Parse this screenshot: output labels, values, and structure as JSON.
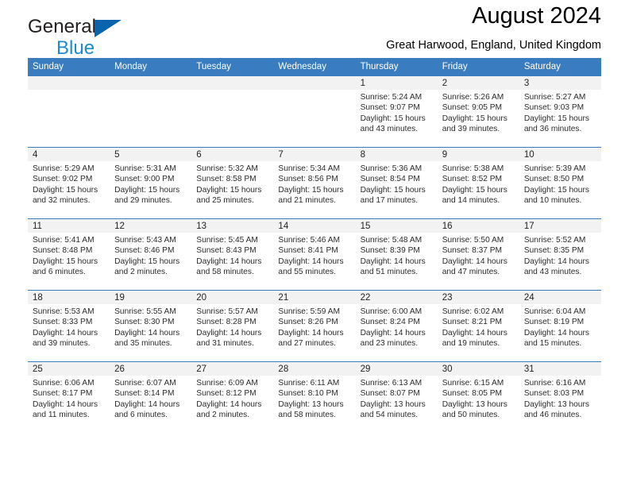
{
  "brand": {
    "name_top": "General",
    "name_bottom": "Blue",
    "flag_icon": "triangle-flag-icon",
    "accent_dark": "#0a63ad",
    "accent_light": "#1b8bd0"
  },
  "header": {
    "title": "August 2024",
    "location": "Great Harwood, England, United Kingdom"
  },
  "theme": {
    "header_row_bg": "#3a7cc0",
    "daynum_band_bg": "#f2f2f2",
    "row_divider": "#3a7cc0",
    "page_bg": "#ffffff"
  },
  "calendar": {
    "weekday_headers": [
      "Sunday",
      "Monday",
      "Tuesday",
      "Wednesday",
      "Thursday",
      "Friday",
      "Saturday"
    ],
    "weeks": [
      [
        {
          "day": "",
          "empty": true,
          "sunrise": "",
          "sunset": "",
          "daylight_line1": "",
          "daylight_line2": ""
        },
        {
          "day": "",
          "empty": true,
          "sunrise": "",
          "sunset": "",
          "daylight_line1": "",
          "daylight_line2": ""
        },
        {
          "day": "",
          "empty": true,
          "sunrise": "",
          "sunset": "",
          "daylight_line1": "",
          "daylight_line2": ""
        },
        {
          "day": "",
          "empty": true,
          "sunrise": "",
          "sunset": "",
          "daylight_line1": "",
          "daylight_line2": ""
        },
        {
          "day": "1",
          "empty": false,
          "sunrise": "Sunrise: 5:24 AM",
          "sunset": "Sunset: 9:07 PM",
          "daylight_line1": "Daylight: 15 hours",
          "daylight_line2": "and 43 minutes."
        },
        {
          "day": "2",
          "empty": false,
          "sunrise": "Sunrise: 5:26 AM",
          "sunset": "Sunset: 9:05 PM",
          "daylight_line1": "Daylight: 15 hours",
          "daylight_line2": "and 39 minutes."
        },
        {
          "day": "3",
          "empty": false,
          "sunrise": "Sunrise: 5:27 AM",
          "sunset": "Sunset: 9:03 PM",
          "daylight_line1": "Daylight: 15 hours",
          "daylight_line2": "and 36 minutes."
        }
      ],
      [
        {
          "day": "4",
          "empty": false,
          "sunrise": "Sunrise: 5:29 AM",
          "sunset": "Sunset: 9:02 PM",
          "daylight_line1": "Daylight: 15 hours",
          "daylight_line2": "and 32 minutes."
        },
        {
          "day": "5",
          "empty": false,
          "sunrise": "Sunrise: 5:31 AM",
          "sunset": "Sunset: 9:00 PM",
          "daylight_line1": "Daylight: 15 hours",
          "daylight_line2": "and 29 minutes."
        },
        {
          "day": "6",
          "empty": false,
          "sunrise": "Sunrise: 5:32 AM",
          "sunset": "Sunset: 8:58 PM",
          "daylight_line1": "Daylight: 15 hours",
          "daylight_line2": "and 25 minutes."
        },
        {
          "day": "7",
          "empty": false,
          "sunrise": "Sunrise: 5:34 AM",
          "sunset": "Sunset: 8:56 PM",
          "daylight_line1": "Daylight: 15 hours",
          "daylight_line2": "and 21 minutes."
        },
        {
          "day": "8",
          "empty": false,
          "sunrise": "Sunrise: 5:36 AM",
          "sunset": "Sunset: 8:54 PM",
          "daylight_line1": "Daylight: 15 hours",
          "daylight_line2": "and 17 minutes."
        },
        {
          "day": "9",
          "empty": false,
          "sunrise": "Sunrise: 5:38 AM",
          "sunset": "Sunset: 8:52 PM",
          "daylight_line1": "Daylight: 15 hours",
          "daylight_line2": "and 14 minutes."
        },
        {
          "day": "10",
          "empty": false,
          "sunrise": "Sunrise: 5:39 AM",
          "sunset": "Sunset: 8:50 PM",
          "daylight_line1": "Daylight: 15 hours",
          "daylight_line2": "and 10 minutes."
        }
      ],
      [
        {
          "day": "11",
          "empty": false,
          "sunrise": "Sunrise: 5:41 AM",
          "sunset": "Sunset: 8:48 PM",
          "daylight_line1": "Daylight: 15 hours",
          "daylight_line2": "and 6 minutes."
        },
        {
          "day": "12",
          "empty": false,
          "sunrise": "Sunrise: 5:43 AM",
          "sunset": "Sunset: 8:46 PM",
          "daylight_line1": "Daylight: 15 hours",
          "daylight_line2": "and 2 minutes."
        },
        {
          "day": "13",
          "empty": false,
          "sunrise": "Sunrise: 5:45 AM",
          "sunset": "Sunset: 8:43 PM",
          "daylight_line1": "Daylight: 14 hours",
          "daylight_line2": "and 58 minutes."
        },
        {
          "day": "14",
          "empty": false,
          "sunrise": "Sunrise: 5:46 AM",
          "sunset": "Sunset: 8:41 PM",
          "daylight_line1": "Daylight: 14 hours",
          "daylight_line2": "and 55 minutes."
        },
        {
          "day": "15",
          "empty": false,
          "sunrise": "Sunrise: 5:48 AM",
          "sunset": "Sunset: 8:39 PM",
          "daylight_line1": "Daylight: 14 hours",
          "daylight_line2": "and 51 minutes."
        },
        {
          "day": "16",
          "empty": false,
          "sunrise": "Sunrise: 5:50 AM",
          "sunset": "Sunset: 8:37 PM",
          "daylight_line1": "Daylight: 14 hours",
          "daylight_line2": "and 47 minutes."
        },
        {
          "day": "17",
          "empty": false,
          "sunrise": "Sunrise: 5:52 AM",
          "sunset": "Sunset: 8:35 PM",
          "daylight_line1": "Daylight: 14 hours",
          "daylight_line2": "and 43 minutes."
        }
      ],
      [
        {
          "day": "18",
          "empty": false,
          "sunrise": "Sunrise: 5:53 AM",
          "sunset": "Sunset: 8:33 PM",
          "daylight_line1": "Daylight: 14 hours",
          "daylight_line2": "and 39 minutes."
        },
        {
          "day": "19",
          "empty": false,
          "sunrise": "Sunrise: 5:55 AM",
          "sunset": "Sunset: 8:30 PM",
          "daylight_line1": "Daylight: 14 hours",
          "daylight_line2": "and 35 minutes."
        },
        {
          "day": "20",
          "empty": false,
          "sunrise": "Sunrise: 5:57 AM",
          "sunset": "Sunset: 8:28 PM",
          "daylight_line1": "Daylight: 14 hours",
          "daylight_line2": "and 31 minutes."
        },
        {
          "day": "21",
          "empty": false,
          "sunrise": "Sunrise: 5:59 AM",
          "sunset": "Sunset: 8:26 PM",
          "daylight_line1": "Daylight: 14 hours",
          "daylight_line2": "and 27 minutes."
        },
        {
          "day": "22",
          "empty": false,
          "sunrise": "Sunrise: 6:00 AM",
          "sunset": "Sunset: 8:24 PM",
          "daylight_line1": "Daylight: 14 hours",
          "daylight_line2": "and 23 minutes."
        },
        {
          "day": "23",
          "empty": false,
          "sunrise": "Sunrise: 6:02 AM",
          "sunset": "Sunset: 8:21 PM",
          "daylight_line1": "Daylight: 14 hours",
          "daylight_line2": "and 19 minutes."
        },
        {
          "day": "24",
          "empty": false,
          "sunrise": "Sunrise: 6:04 AM",
          "sunset": "Sunset: 8:19 PM",
          "daylight_line1": "Daylight: 14 hours",
          "daylight_line2": "and 15 minutes."
        }
      ],
      [
        {
          "day": "25",
          "empty": false,
          "sunrise": "Sunrise: 6:06 AM",
          "sunset": "Sunset: 8:17 PM",
          "daylight_line1": "Daylight: 14 hours",
          "daylight_line2": "and 11 minutes."
        },
        {
          "day": "26",
          "empty": false,
          "sunrise": "Sunrise: 6:07 AM",
          "sunset": "Sunset: 8:14 PM",
          "daylight_line1": "Daylight: 14 hours",
          "daylight_line2": "and 6 minutes."
        },
        {
          "day": "27",
          "empty": false,
          "sunrise": "Sunrise: 6:09 AM",
          "sunset": "Sunset: 8:12 PM",
          "daylight_line1": "Daylight: 14 hours",
          "daylight_line2": "and 2 minutes."
        },
        {
          "day": "28",
          "empty": false,
          "sunrise": "Sunrise: 6:11 AM",
          "sunset": "Sunset: 8:10 PM",
          "daylight_line1": "Daylight: 13 hours",
          "daylight_line2": "and 58 minutes."
        },
        {
          "day": "29",
          "empty": false,
          "sunrise": "Sunrise: 6:13 AM",
          "sunset": "Sunset: 8:07 PM",
          "daylight_line1": "Daylight: 13 hours",
          "daylight_line2": "and 54 minutes."
        },
        {
          "day": "30",
          "empty": false,
          "sunrise": "Sunrise: 6:15 AM",
          "sunset": "Sunset: 8:05 PM",
          "daylight_line1": "Daylight: 13 hours",
          "daylight_line2": "and 50 minutes."
        },
        {
          "day": "31",
          "empty": false,
          "sunrise": "Sunrise: 6:16 AM",
          "sunset": "Sunset: 8:03 PM",
          "daylight_line1": "Daylight: 13 hours",
          "daylight_line2": "and 46 minutes."
        }
      ]
    ]
  }
}
